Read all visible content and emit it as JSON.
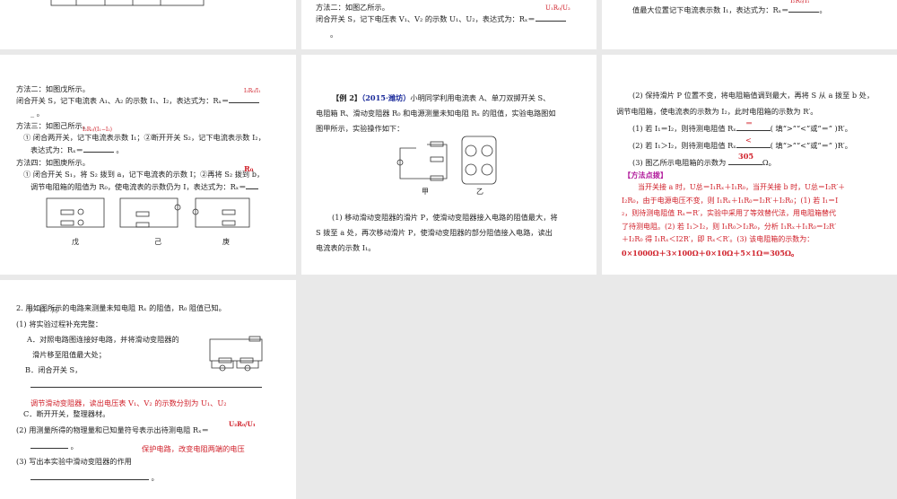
{
  "p1": {
    "dummy": ""
  },
  "p2": {
    "l1": "方法二：如图乙所示。",
    "l2": "闭合开关 S，记下电压表 V₁、V₂ 的示数 U₁、U₂，表达式为：Rₓ＝",
    "ans": "U₁R₀/U₂",
    "l3": "。"
  },
  "p3": {
    "l1": "值最大位置记下电流表示数 I₁，表达式为：Rₓ＝",
    "ans": "I₂R₀/I₁",
    "l2": "。"
  },
  "p4": {
    "m2": "方法二：如图戊所示。",
    "m2a": "闭合开关 S，记下电流表 A₁、A₂ 的示数 I₁、I₂，表达式为：Rₓ＝",
    "m2ans": "I₂R₀/I₁",
    "m3": "方法三：如图己所示。",
    "m3a": "① 闭合两开关，记下电流表示数 I₁；②断开开关 S₂，记下电流表示数 I₂，",
    "m3b": "表达式为：Rₓ＝",
    "m3ans": "I₂R₀/(I₁−I₂)",
    "m4": "方法四：如图庚所示。",
    "m4a": "① 闭合开关 S₁，将 S₂ 拨到 a，记下电流表的示数 I；②再将 S₂ 拨到 b，",
    "m4b": "调节电阻箱的阻值为 R₀，使电流表的示数仍为 I，表达式为：Rₓ＝",
    "m4ans": "R₀",
    "figs": [
      "戊",
      "己",
      "庚"
    ]
  },
  "p5": {
    "ex": "【例 2】",
    "src": "（2015·潍坊）",
    "l1": "小明同学利用电流表 A、单刀双掷开关 S、",
    "l2": "电阻箱 R、滑动变阻器 R₀ 和电源测量未知电阻 Rₓ 的阻值，实验电路图如",
    "l3": "图甲所示，实验操作如下：",
    "figs": [
      "甲",
      "乙"
    ],
    "q1a": "(1) 移动滑动变阻器的滑片 P，使滑动变阻器接入电路的阻值最大，将",
    "q1b": "S 拨至 a 处，再次移动滑片 P，使滑动变阻器的部分阻值接入电路，读出",
    "q1c": "电流表的示数 I₁。"
  },
  "p6": {
    "q2a": "(2) 保持滑片 P 位置不变，将电阻箱值调到最大，再将 S 从 a 拨至 b 处，",
    "q2b": "调节电阻箱，使电流表的示数为 I₂，此时电阻箱的示数为 R′。",
    "s1": "(1) 若 I₁＝I₂，则待测电阻值 Rₓ",
    "s1ans": "＝",
    "s1t": "( 填“>”“<”或“＝” )R′。",
    "s2": "(2) 若 I₁＞I₂，则待测电阻值 Rₓ",
    "s2ans": "<",
    "s2t": "( 填“>”“<”或“＝” )R′。",
    "s3": "(3) 图乙所示电阻箱的示数为",
    "s3ans": "305",
    "s3t": "Ω。",
    "tip": "【方法点拨】",
    "e1": "当开关接 a 时，U总＝I₁Rₓ＋I₁R₀，当开关接 b 时，U总＝I₂R′＋",
    "e2": "I₂R₀，由于电源电压不变，则 I₁Rₓ＋I₁R₀＝I₂R′＋I₂R₀；(1) 若 I₁＝I",
    "e3": "₂，则待测电阻值 Rₓ＝R′，实验中采用了等效替代法，用电阻箱替代",
    "e4": "了待测电阻。(2) 若 I₁＞I₂，则 I₁R₀＞I₂R₀，分析 I₁Rₓ＋I₁R₀＝I₂R′",
    "e5": "＋I₂R₀ 得 I₁Rₓ＜I2R′，即 Rₓ＜R′。(3) 该电阻箱的示数为：",
    "e6": "0×1000Ω＋3×100Ω＋0×10Ω＋5×1Ω＝305Ω。"
  },
  "p7": {
    "h": "2. 用如图所示的电路来测量未知电阻 Rₓ 的阻值，R₀ 阻值已知。",
    "hov": "学 · 科 · 网",
    "q1": "(1) 将实验过程补充完整：",
    "a1": "A．对照电路图连接好电路，并将滑动变阻器的",
    "a2": "滑片移至阻值最大处；",
    "b": "B．闭合开关 S，",
    "bans": "调节滑动变阻器，读出电压表 V₁、V₂ 的示数分别为 U₁、U₂",
    "c": "C．断开开关，整理器材。",
    "q2": "(2) 用测量所得的物理量和已知量符号表示出待测电阻 Rₓ＝",
    "q2ans": "U₂R₀/U₁",
    "q3": "(3) 写出本实验中滑动变阻器的作用",
    "q3ans": "保护电路，改变电阻两端的电压"
  }
}
